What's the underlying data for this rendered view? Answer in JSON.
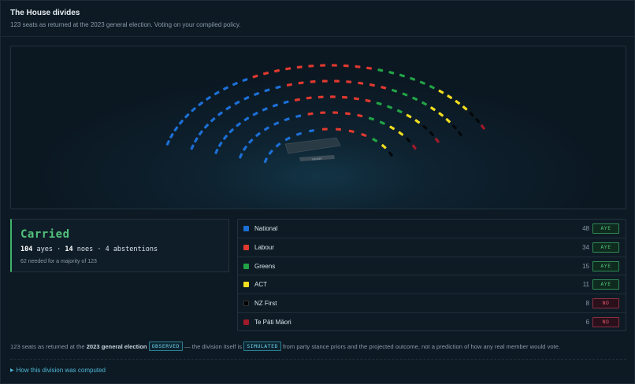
{
  "header": {
    "title": "The House divides",
    "subtitle": "123 seats as returned at the 2023 general election. Voting on your compiled policy."
  },
  "chamber": {
    "table_label": "SPEAKER",
    "rows": [
      {
        "seats": 13,
        "parties": [
          "National",
          "National",
          "National",
          "National",
          "National",
          "National",
          "Labour",
          "Labour",
          "Labour",
          "Labour",
          "Greens",
          "ACT",
          "NZ First"
        ]
      },
      {
        "seats": 19,
        "parties": [
          "National",
          "National",
          "National",
          "National",
          "National",
          "National",
          "National",
          "National",
          "Labour",
          "Labour",
          "Labour",
          "Labour",
          "Labour",
          "Greens",
          "Greens",
          "ACT",
          "ACT",
          "NZ First",
          "Te Pāti Māori"
        ]
      },
      {
        "seats": 25,
        "parties": [
          "National",
          "National",
          "National",
          "National",
          "National",
          "National",
          "National",
          "National",
          "National",
          "National",
          "Labour",
          "Labour",
          "Labour",
          "Labour",
          "Labour",
          "Labour",
          "Labour",
          "Greens",
          "Greens",
          "Greens",
          "ACT",
          "ACT",
          "NZ First",
          "NZ First",
          "Te Pāti Māori"
        ]
      },
      {
        "seats": 30,
        "parties": [
          "National",
          "National",
          "National",
          "National",
          "National",
          "National",
          "National",
          "National",
          "National",
          "National",
          "National",
          "National",
          "Labour",
          "Labour",
          "Labour",
          "Labour",
          "Labour",
          "Labour",
          "Labour",
          "Labour",
          "Labour",
          "Greens",
          "Greens",
          "Greens",
          "Greens",
          "ACT",
          "ACT",
          "ACT",
          "NZ First",
          "NZ First"
        ]
      },
      {
        "seats": 36,
        "parties": [
          "National",
          "National",
          "National",
          "National",
          "National",
          "National",
          "National",
          "National",
          "National",
          "National",
          "National",
          "National",
          "Labour",
          "Labour",
          "Labour",
          "Labour",
          "Labour",
          "Labour",
          "Labour",
          "Labour",
          "Labour",
          "Labour",
          "Labour",
          "Greens",
          "Greens",
          "Greens",
          "Greens",
          "Greens",
          "Greens",
          "ACT",
          "ACT",
          "ACT",
          "ACT",
          "NZ First",
          "NZ First",
          "Te Pāti Māori"
        ]
      }
    ]
  },
  "result": {
    "title": "Carried",
    "ayes": "104",
    "ayes_label": "ayes",
    "noes": "14",
    "noes_label": "noes",
    "sep": "·",
    "abstentions_text": "4 abstentions",
    "note": "62 needed for a majority of 123"
  },
  "parties": [
    {
      "name": "National",
      "seats": "48",
      "vote": "AYE",
      "color": "#1c6fd6"
    },
    {
      "name": "Labour",
      "seats": "34",
      "vote": "AYE",
      "color": "#e0392f"
    },
    {
      "name": "Greens",
      "seats": "15",
      "vote": "AYE",
      "color": "#22a346"
    },
    {
      "name": "ACT",
      "seats": "11",
      "vote": "AYE",
      "color": "#f2de1f"
    },
    {
      "name": "NZ First",
      "seats": "8",
      "vote": "NO",
      "color": "#000000"
    },
    {
      "name": "Te Pāti Māori",
      "seats": "6",
      "vote": "NO",
      "color": "#a11a2a"
    }
  ],
  "footnote": {
    "part1": "123 seats as returned at the ",
    "bold": "2023 general election",
    "tag1": "OBSERVED",
    "part2": " — the division itself is ",
    "tag2": "SIMULATED",
    "part3": " from party stance priors and the projected outcome, not a prediction of how any real member would vote."
  },
  "details": {
    "label": "How this division was computed"
  }
}
